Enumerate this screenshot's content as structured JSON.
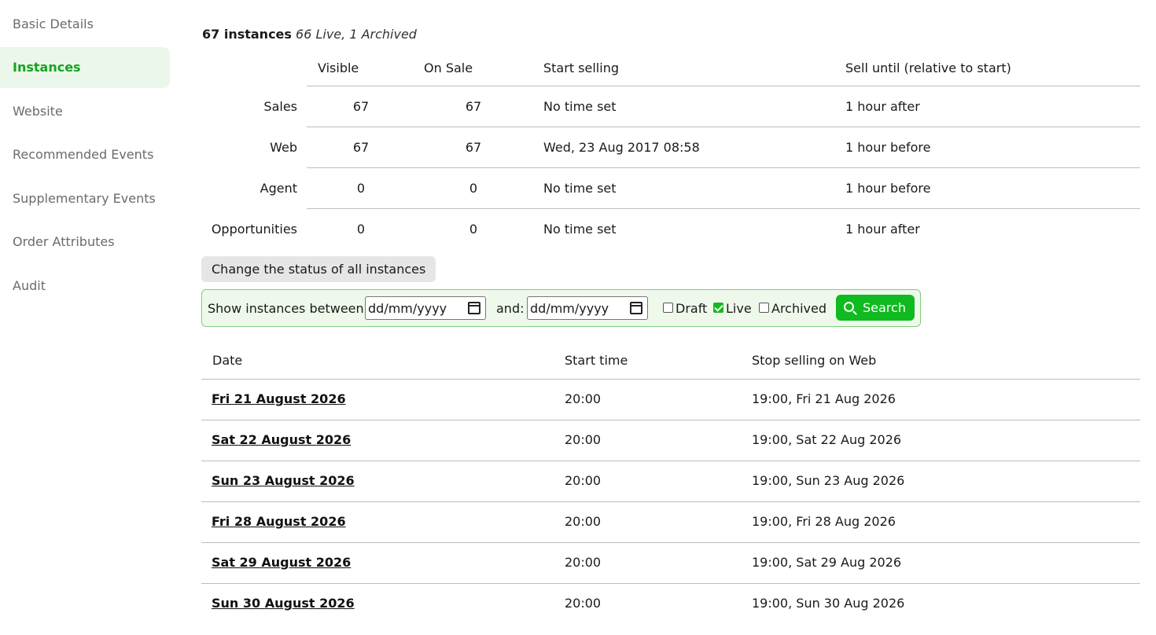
{
  "sidebar": {
    "items": [
      {
        "label": "Basic Details"
      },
      {
        "label": "Instances",
        "active": true
      },
      {
        "label": "Website"
      },
      {
        "label": "Recommended Events"
      },
      {
        "label": "Supplementary Events"
      },
      {
        "label": "Order Attributes"
      },
      {
        "label": "Audit"
      }
    ]
  },
  "summary": {
    "count": "67 instances",
    "sub": "66 Live, 1 Archived"
  },
  "channels": {
    "headers": {
      "visible": "Visible",
      "on_sale": "On Sale",
      "start": "Start selling",
      "until": "Sell until (relative to start)"
    },
    "rows": [
      {
        "name": "Sales",
        "visible": "67",
        "on_sale": "67",
        "start": "No time set",
        "until": "1 hour after"
      },
      {
        "name": "Web",
        "visible": "67",
        "on_sale": "67",
        "start": "Wed, 23 Aug 2017 08:58",
        "until": "1 hour before"
      },
      {
        "name": "Agent",
        "visible": "0",
        "on_sale": "0",
        "start": "No time set",
        "until": "1 hour before"
      },
      {
        "name": "Opportunities",
        "visible": "0",
        "on_sale": "0",
        "start": "No time set",
        "until": "1 hour after"
      }
    ]
  },
  "status_button": "Change the status of all instances",
  "filter": {
    "between_label": "Show instances between:",
    "from_placeholder": "dd/mm/yyyy",
    "and_label": "and:",
    "to_placeholder": "dd/mm/yyyy",
    "draft": {
      "label": "Draft",
      "checked": false
    },
    "live": {
      "label": "Live",
      "checked": true
    },
    "archived": {
      "label": "Archived",
      "checked": false
    },
    "search_label": "Search"
  },
  "instances": {
    "headers": {
      "date": "Date",
      "start": "Start time",
      "stop": "Stop selling on Web"
    },
    "rows": [
      {
        "date": "Fri 21 August 2026",
        "start": "20:00",
        "stop": "19:00, Fri 21 Aug 2026"
      },
      {
        "date": "Sat 22 August 2026",
        "start": "20:00",
        "stop": "19:00, Sat 22 Aug 2026"
      },
      {
        "date": "Sun 23 August 2026",
        "start": "20:00",
        "stop": "19:00, Sun 23 Aug 2026"
      },
      {
        "date": "Fri 28 August 2026",
        "start": "20:00",
        "stop": "19:00, Fri 28 Aug 2026"
      },
      {
        "date": "Sat 29 August 2026",
        "start": "20:00",
        "stop": "19:00, Sat 29 Aug 2026"
      },
      {
        "date": "Sun 30 August 2026",
        "start": "20:00",
        "stop": "19:00, Sun 30 Aug 2026"
      }
    ]
  },
  "colors": {
    "accent": "#16a41f",
    "search_button": "#0fbb1e",
    "filter_bg": "#eef9ec"
  }
}
